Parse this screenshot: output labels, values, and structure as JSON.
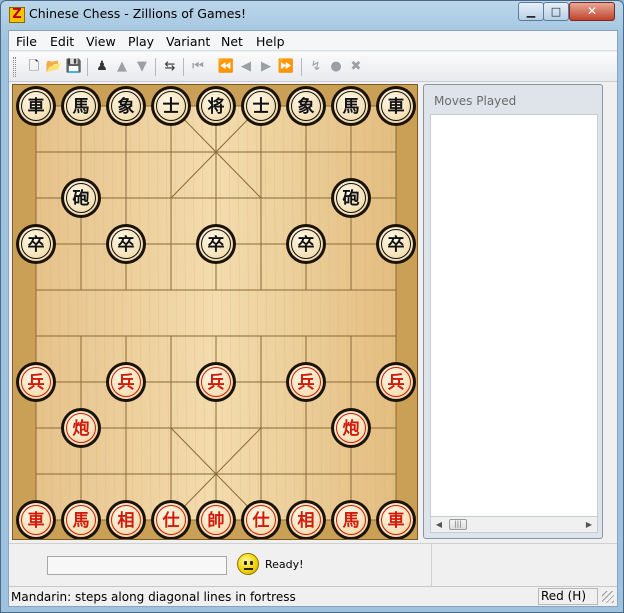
{
  "window": {
    "title": "Chinese Chess - Zillions of Games!",
    "app_icon": "Z",
    "minimize_icon": "minimize-icon",
    "maximize_icon": "maximize-icon",
    "close_icon": "close-icon"
  },
  "menu": [
    "File",
    "Edit",
    "View",
    "Play",
    "Variant",
    "Net",
    "Help"
  ],
  "toolbar": {
    "buttons": [
      {
        "name": "new-icon",
        "glyph": "🗋",
        "enabled": true
      },
      {
        "name": "open-icon",
        "glyph": "📂",
        "enabled": true
      },
      {
        "name": "save-icon",
        "glyph": "💾",
        "enabled": true
      },
      {
        "name": "start-game-icon",
        "glyph": "♟",
        "enabled": true
      },
      {
        "name": "move-up-icon",
        "glyph": "▲",
        "enabled": false
      },
      {
        "name": "move-down-icon",
        "glyph": "▼",
        "enabled": false
      },
      {
        "name": "switch-sides-icon",
        "glyph": "⇆",
        "enabled": true
      },
      {
        "name": "first-move-icon",
        "glyph": "⏮",
        "enabled": false
      },
      {
        "name": "undo-all-icon",
        "glyph": "⏪",
        "enabled": false
      },
      {
        "name": "undo-move-icon",
        "glyph": "◀",
        "enabled": false
      },
      {
        "name": "redo-move-icon",
        "glyph": "▶",
        "enabled": false
      },
      {
        "name": "redo-all-icon",
        "glyph": "⏩",
        "enabled": false
      },
      {
        "name": "hint-icon",
        "glyph": "↯",
        "enabled": false
      },
      {
        "name": "stop-icon",
        "glyph": "●",
        "enabled": false
      },
      {
        "name": "cancel-icon",
        "glyph": "✖",
        "enabled": false
      }
    ]
  },
  "board": {
    "files": 9,
    "ranks": 10,
    "black_color": "#111111",
    "red_color": "#d21a0a",
    "pieces": [
      {
        "side": "black",
        "label": "車",
        "file": 0,
        "rank": 0
      },
      {
        "side": "black",
        "label": "馬",
        "file": 1,
        "rank": 0
      },
      {
        "side": "black",
        "label": "象",
        "file": 2,
        "rank": 0
      },
      {
        "side": "black",
        "label": "士",
        "file": 3,
        "rank": 0
      },
      {
        "side": "black",
        "label": "将",
        "file": 4,
        "rank": 0
      },
      {
        "side": "black",
        "label": "士",
        "file": 5,
        "rank": 0
      },
      {
        "side": "black",
        "label": "象",
        "file": 6,
        "rank": 0
      },
      {
        "side": "black",
        "label": "馬",
        "file": 7,
        "rank": 0
      },
      {
        "side": "black",
        "label": "車",
        "file": 8,
        "rank": 0
      },
      {
        "side": "black",
        "label": "砲",
        "file": 1,
        "rank": 2
      },
      {
        "side": "black",
        "label": "砲",
        "file": 7,
        "rank": 2
      },
      {
        "side": "black",
        "label": "卒",
        "file": 0,
        "rank": 3
      },
      {
        "side": "black",
        "label": "卒",
        "file": 2,
        "rank": 3
      },
      {
        "side": "black",
        "label": "卒",
        "file": 4,
        "rank": 3
      },
      {
        "side": "black",
        "label": "卒",
        "file": 6,
        "rank": 3
      },
      {
        "side": "black",
        "label": "卒",
        "file": 8,
        "rank": 3
      },
      {
        "side": "red",
        "label": "兵",
        "file": 0,
        "rank": 6
      },
      {
        "side": "red",
        "label": "兵",
        "file": 2,
        "rank": 6
      },
      {
        "side": "red",
        "label": "兵",
        "file": 4,
        "rank": 6
      },
      {
        "side": "red",
        "label": "兵",
        "file": 6,
        "rank": 6
      },
      {
        "side": "red",
        "label": "兵",
        "file": 8,
        "rank": 6
      },
      {
        "side": "red",
        "label": "炮",
        "file": 1,
        "rank": 7
      },
      {
        "side": "red",
        "label": "炮",
        "file": 7,
        "rank": 7
      },
      {
        "side": "red",
        "label": "車",
        "file": 0,
        "rank": 9
      },
      {
        "side": "red",
        "label": "馬",
        "file": 1,
        "rank": 9
      },
      {
        "side": "red",
        "label": "相",
        "file": 2,
        "rank": 9
      },
      {
        "side": "red",
        "label": "仕",
        "file": 3,
        "rank": 9
      },
      {
        "side": "red",
        "label": "帥",
        "file": 4,
        "rank": 9
      },
      {
        "side": "red",
        "label": "仕",
        "file": 5,
        "rank": 9
      },
      {
        "side": "red",
        "label": "相",
        "file": 6,
        "rank": 9
      },
      {
        "side": "red",
        "label": "馬",
        "file": 7,
        "rank": 9
      },
      {
        "side": "red",
        "label": "車",
        "file": 8,
        "rank": 9
      }
    ]
  },
  "moves_panel": {
    "title": "Moves Played",
    "moves": []
  },
  "status": {
    "ready_text": "Ready!",
    "hint": "Mandarin: steps along diagonal lines in fortress",
    "side_to_move": "Red (H)"
  }
}
